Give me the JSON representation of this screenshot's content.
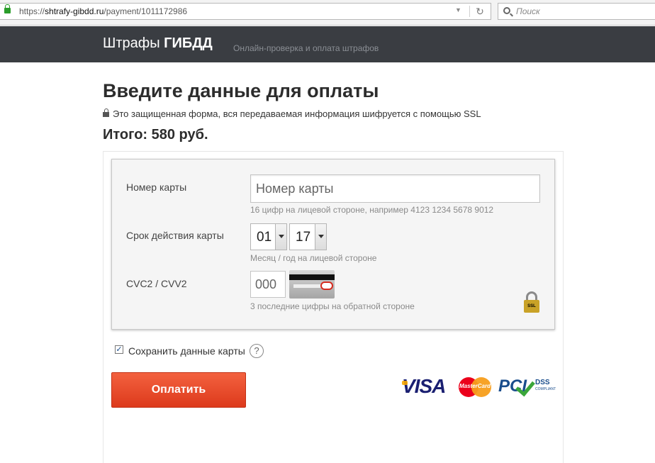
{
  "browser": {
    "url_scheme": "https://",
    "url_host": "shtrafy-gibdd.ru",
    "url_path": "/payment/1011172986",
    "search_placeholder": "Поиск"
  },
  "header": {
    "brand_regular": "Штрафы",
    "brand_bold": "ГИБДД",
    "tagline": "Онлайн-проверка и оплата штрафов"
  },
  "page": {
    "title": "Введите данные для оплаты",
    "secure_note": "Это защищенная форма, вся передаваемая информация шифруется с помощью SSL",
    "total": "Итого: 580 руб."
  },
  "form": {
    "card_number": {
      "label": "Номер карты",
      "placeholder": "Номер карты",
      "hint": "16 цифр на лицевой стороне, например 4123 1234 5678 9012"
    },
    "expiry": {
      "label": "Срок действия карты",
      "month": "01",
      "year": "17",
      "hint": "Месяц / год на лицевой стороне"
    },
    "cvc": {
      "label": "CVC2 / CVV2",
      "placeholder": "000",
      "hint": "3 последние цифры на обратной стороне"
    },
    "ssl_badge_text": "SSL"
  },
  "save_card": {
    "label": "Сохранить данные карты",
    "checked": true,
    "help": "?"
  },
  "pay_button_label": "Оплатить",
  "logos": {
    "visa": "VISA",
    "mastercard": "MasterCard",
    "pci": "PCI",
    "pci_dss": "DSS",
    "pci_compliant": "COMPLIANT"
  },
  "colors": {
    "header_bg": "#3a3d42",
    "pay_button": "#e8492a"
  }
}
